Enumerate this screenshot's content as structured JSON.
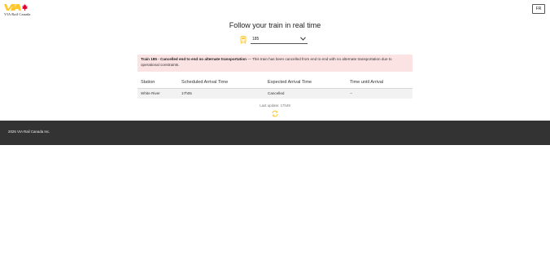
{
  "header": {
    "logo_text": "VIA Rail Canada",
    "lang_button": "FR"
  },
  "main": {
    "title": "Follow your train in real time",
    "train_select": {
      "value": "185"
    },
    "alert": {
      "heading": "Train 185 - Cancelled end to end no alternate transportation",
      "body": " — This train has been cancelled from end to end with no alternate transportation due to operational constraints."
    },
    "table": {
      "headers": [
        "Station",
        "Scheduled Arrival Time",
        "Expected Arrival Time",
        "Time until Arrival"
      ],
      "rows": [
        [
          "White River",
          "17h05",
          "Cancelled",
          "--"
        ]
      ]
    },
    "last_update": "Last update: 17h49"
  },
  "footer": {
    "copyright": "2025 VIA Rail Canada Inc."
  },
  "colors": {
    "brand_yellow": "#ffc72c",
    "maple_red": "#e4002b",
    "alert_bg": "#fbe3e4",
    "footer_bg": "#333333"
  },
  "icons": {
    "train": "train-icon",
    "chevron": "chevron-down-icon",
    "refresh": "refresh-icon",
    "logo": "via-rail-logo"
  }
}
